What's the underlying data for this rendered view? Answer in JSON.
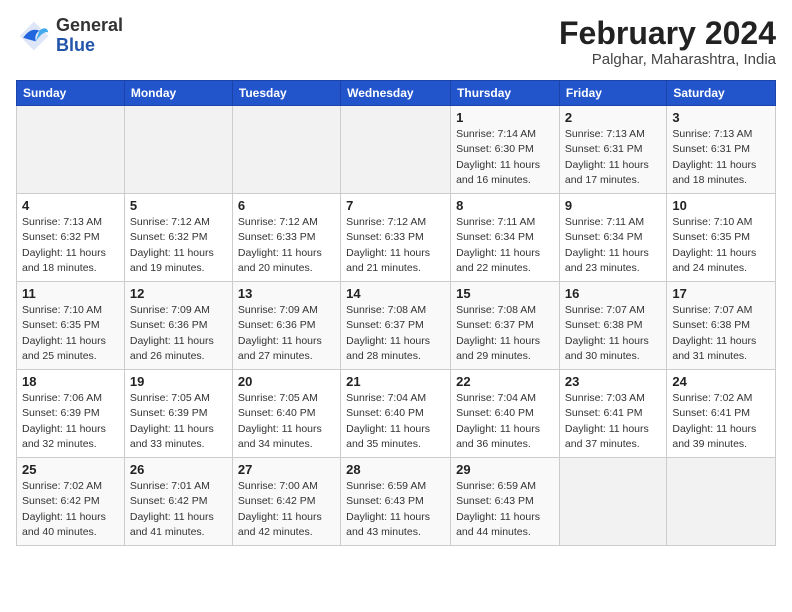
{
  "header": {
    "logo_text_general": "General",
    "logo_text_blue": "Blue",
    "month_year": "February 2024",
    "location": "Palghar, Maharashtra, India"
  },
  "weekdays": [
    "Sunday",
    "Monday",
    "Tuesday",
    "Wednesday",
    "Thursday",
    "Friday",
    "Saturday"
  ],
  "weeks": [
    [
      {
        "day": "",
        "info": ""
      },
      {
        "day": "",
        "info": ""
      },
      {
        "day": "",
        "info": ""
      },
      {
        "day": "",
        "info": ""
      },
      {
        "day": "1",
        "info": "Sunrise: 7:14 AM\nSunset: 6:30 PM\nDaylight: 11 hours\nand 16 minutes."
      },
      {
        "day": "2",
        "info": "Sunrise: 7:13 AM\nSunset: 6:31 PM\nDaylight: 11 hours\nand 17 minutes."
      },
      {
        "day": "3",
        "info": "Sunrise: 7:13 AM\nSunset: 6:31 PM\nDaylight: 11 hours\nand 18 minutes."
      }
    ],
    [
      {
        "day": "4",
        "info": "Sunrise: 7:13 AM\nSunset: 6:32 PM\nDaylight: 11 hours\nand 18 minutes."
      },
      {
        "day": "5",
        "info": "Sunrise: 7:12 AM\nSunset: 6:32 PM\nDaylight: 11 hours\nand 19 minutes."
      },
      {
        "day": "6",
        "info": "Sunrise: 7:12 AM\nSunset: 6:33 PM\nDaylight: 11 hours\nand 20 minutes."
      },
      {
        "day": "7",
        "info": "Sunrise: 7:12 AM\nSunset: 6:33 PM\nDaylight: 11 hours\nand 21 minutes."
      },
      {
        "day": "8",
        "info": "Sunrise: 7:11 AM\nSunset: 6:34 PM\nDaylight: 11 hours\nand 22 minutes."
      },
      {
        "day": "9",
        "info": "Sunrise: 7:11 AM\nSunset: 6:34 PM\nDaylight: 11 hours\nand 23 minutes."
      },
      {
        "day": "10",
        "info": "Sunrise: 7:10 AM\nSunset: 6:35 PM\nDaylight: 11 hours\nand 24 minutes."
      }
    ],
    [
      {
        "day": "11",
        "info": "Sunrise: 7:10 AM\nSunset: 6:35 PM\nDaylight: 11 hours\nand 25 minutes."
      },
      {
        "day": "12",
        "info": "Sunrise: 7:09 AM\nSunset: 6:36 PM\nDaylight: 11 hours\nand 26 minutes."
      },
      {
        "day": "13",
        "info": "Sunrise: 7:09 AM\nSunset: 6:36 PM\nDaylight: 11 hours\nand 27 minutes."
      },
      {
        "day": "14",
        "info": "Sunrise: 7:08 AM\nSunset: 6:37 PM\nDaylight: 11 hours\nand 28 minutes."
      },
      {
        "day": "15",
        "info": "Sunrise: 7:08 AM\nSunset: 6:37 PM\nDaylight: 11 hours\nand 29 minutes."
      },
      {
        "day": "16",
        "info": "Sunrise: 7:07 AM\nSunset: 6:38 PM\nDaylight: 11 hours\nand 30 minutes."
      },
      {
        "day": "17",
        "info": "Sunrise: 7:07 AM\nSunset: 6:38 PM\nDaylight: 11 hours\nand 31 minutes."
      }
    ],
    [
      {
        "day": "18",
        "info": "Sunrise: 7:06 AM\nSunset: 6:39 PM\nDaylight: 11 hours\nand 32 minutes."
      },
      {
        "day": "19",
        "info": "Sunrise: 7:05 AM\nSunset: 6:39 PM\nDaylight: 11 hours\nand 33 minutes."
      },
      {
        "day": "20",
        "info": "Sunrise: 7:05 AM\nSunset: 6:40 PM\nDaylight: 11 hours\nand 34 minutes."
      },
      {
        "day": "21",
        "info": "Sunrise: 7:04 AM\nSunset: 6:40 PM\nDaylight: 11 hours\nand 35 minutes."
      },
      {
        "day": "22",
        "info": "Sunrise: 7:04 AM\nSunset: 6:40 PM\nDaylight: 11 hours\nand 36 minutes."
      },
      {
        "day": "23",
        "info": "Sunrise: 7:03 AM\nSunset: 6:41 PM\nDaylight: 11 hours\nand 37 minutes."
      },
      {
        "day": "24",
        "info": "Sunrise: 7:02 AM\nSunset: 6:41 PM\nDaylight: 11 hours\nand 39 minutes."
      }
    ],
    [
      {
        "day": "25",
        "info": "Sunrise: 7:02 AM\nSunset: 6:42 PM\nDaylight: 11 hours\nand 40 minutes."
      },
      {
        "day": "26",
        "info": "Sunrise: 7:01 AM\nSunset: 6:42 PM\nDaylight: 11 hours\nand 41 minutes."
      },
      {
        "day": "27",
        "info": "Sunrise: 7:00 AM\nSunset: 6:42 PM\nDaylight: 11 hours\nand 42 minutes."
      },
      {
        "day": "28",
        "info": "Sunrise: 6:59 AM\nSunset: 6:43 PM\nDaylight: 11 hours\nand 43 minutes."
      },
      {
        "day": "29",
        "info": "Sunrise: 6:59 AM\nSunset: 6:43 PM\nDaylight: 11 hours\nand 44 minutes."
      },
      {
        "day": "",
        "info": ""
      },
      {
        "day": "",
        "info": ""
      }
    ]
  ]
}
